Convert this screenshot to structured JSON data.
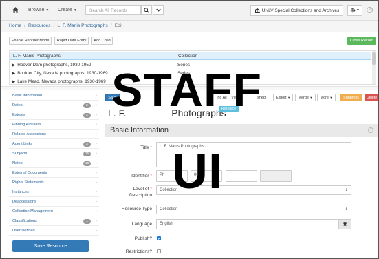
{
  "navbar": {
    "browse_label": "Browse",
    "create_label": "Create",
    "search_placeholder": "Search All Records",
    "repository_label": "UNLV Special Collections and Archives",
    "help_label": "?"
  },
  "breadcrumb": {
    "items": [
      "Home",
      "Resources",
      "L. F. Manis Photographs",
      "Edit"
    ]
  },
  "toolbar": {
    "reorder_label": "Enable Reorder Mode",
    "rapid_label": "Rapid Data Entry",
    "add_child_label": "Add Child",
    "close_label": "Close Record"
  },
  "tree": {
    "rows": [
      {
        "title": "L. F. Manis Photographs",
        "level": "Collection"
      },
      {
        "title": "Hoover Dam photographs, 1930-1959",
        "level": "Series"
      },
      {
        "title": "Boulder City, Nevada photographs, 1930-1969",
        "level": "Series"
      },
      {
        "title": "Lake Mead, Nevada photographs, 1930-1969",
        "level": "Series"
      }
    ]
  },
  "sidebar": {
    "items": [
      {
        "label": "Basic Information",
        "badge": ""
      },
      {
        "label": "Dates",
        "badge": "2"
      },
      {
        "label": "Extents",
        "badge": "2"
      },
      {
        "label": "Finding Aid Data",
        "badge": ""
      },
      {
        "label": "Related Accessions",
        "badge": ""
      },
      {
        "label": "Agent Links",
        "badge": "3"
      },
      {
        "label": "Subjects",
        "badge": "15"
      },
      {
        "label": "Notes",
        "badge": "10"
      },
      {
        "label": "External Documents",
        "badge": ""
      },
      {
        "label": "Rights Statements",
        "badge": ""
      },
      {
        "label": "Instances",
        "badge": ""
      },
      {
        "label": "Deaccessions",
        "badge": ""
      },
      {
        "label": "Collection Management",
        "badge": ""
      },
      {
        "label": "Classifications",
        "badge": "1"
      },
      {
        "label": "User Defined",
        "badge": ""
      }
    ],
    "save_label": "Save Resource"
  },
  "actions": {
    "save_label": "Save",
    "expand_label": "nd All",
    "view_label": "View",
    "published_label": "shed",
    "export_label": "Export",
    "merge_label": "Merge",
    "more_label": "More",
    "suppress_label": "Suppress",
    "delete_label": "Delete"
  },
  "record": {
    "title_prefix": "L. F.",
    "title_suffix": "Photographs",
    "badge_label": "Resource"
  },
  "form": {
    "section_title": "Basic Information",
    "title_label": "Title",
    "title_value": "L. F. Manis Photographs",
    "identifier_label": "Identifier",
    "identifier_part1": "Ph",
    "identifier_part2": "00",
    "level_label_1": "Level of",
    "level_label_2": "Description",
    "level_value": "Collection",
    "resource_type_label": "Resource Type",
    "resource_type_value": "Collection",
    "language_label": "Language",
    "language_value": "English",
    "publish_label": "Publish?",
    "publish_checked": true,
    "restrictions_label": "Restrictions?",
    "restrictions_checked": false
  },
  "overlay": {
    "line1": "STAFF",
    "line2": "UI"
  },
  "colors": {
    "primary": "#337ab7",
    "success": "#5cb85c",
    "warning": "#f0ad4e",
    "danger": "#d9534f",
    "info": "#5bc0de"
  }
}
